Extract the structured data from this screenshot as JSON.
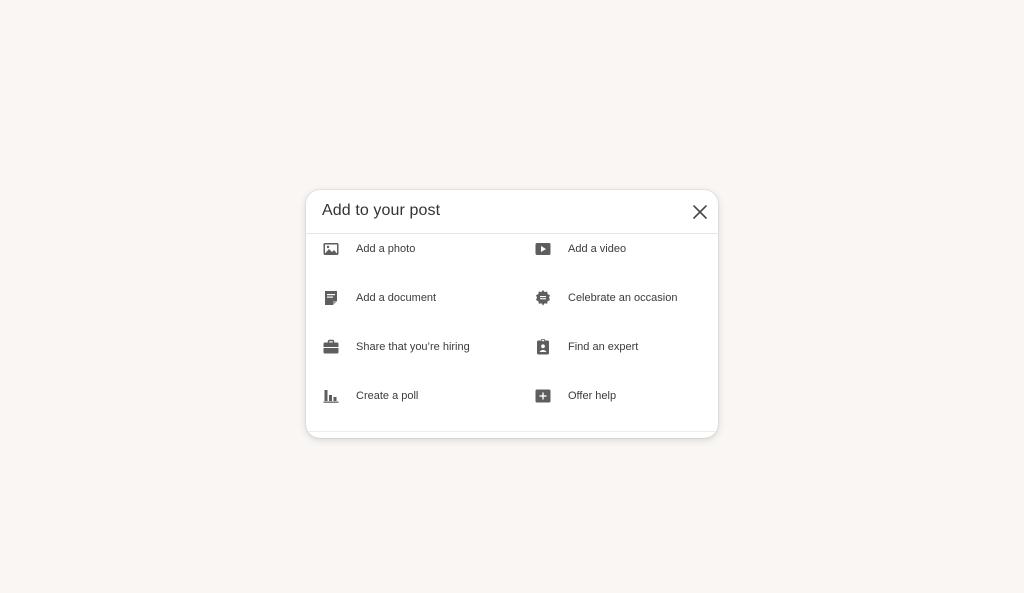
{
  "dialog": {
    "title": "Add to your post",
    "close_icon": "close-icon"
  },
  "options": [
    {
      "label": "Add a photo",
      "icon": "image-icon"
    },
    {
      "label": "Add a video",
      "icon": "video-play-icon"
    },
    {
      "label": "Add a document",
      "icon": "document-icon"
    },
    {
      "label": "Celebrate an occasion",
      "icon": "celebration-badge-icon"
    },
    {
      "label": "Share that you’re hiring",
      "icon": "briefcase-icon"
    },
    {
      "label": "Find an expert",
      "icon": "id-badge-icon"
    },
    {
      "label": "Create a poll",
      "icon": "bar-chart-icon"
    },
    {
      "label": "Offer help",
      "icon": "plus-box-icon"
    }
  ],
  "colors": {
    "background": "#faf6f3",
    "icon": "#5e5e5e",
    "text": "#3b3b3b"
  }
}
